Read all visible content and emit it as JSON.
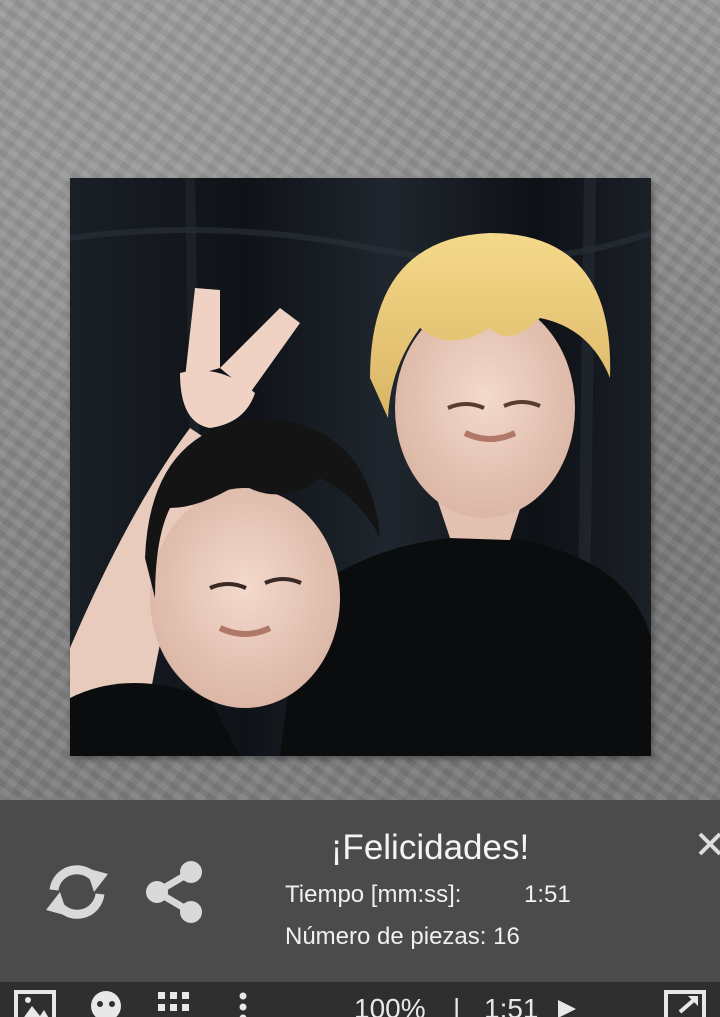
{
  "result": {
    "title": "¡Felicidades!",
    "time_label": "Tiempo [mm:ss]:",
    "time_value": "1:51",
    "pieces_label": "Número de piezas:",
    "pieces_value": "16"
  },
  "actions": {
    "restart_icon": "refresh-icon",
    "share_icon": "share-icon",
    "close_icon": "close-icon"
  },
  "toolbar": {
    "image_icon": "image-icon",
    "puzzle_icon": "puzzle-piece-icon",
    "grid_icon": "grid-dots-icon",
    "menu_icon": "more-vertical-icon",
    "zoom": "100%",
    "separator": "|",
    "timer": "1:51",
    "play_icon": "play-icon",
    "fullscreen_icon": "expand-icon"
  },
  "colors": {
    "panel_bg": "#4b4b4b",
    "toolbar_bg": "#2f2f2f",
    "text": "#f4f4f4"
  }
}
